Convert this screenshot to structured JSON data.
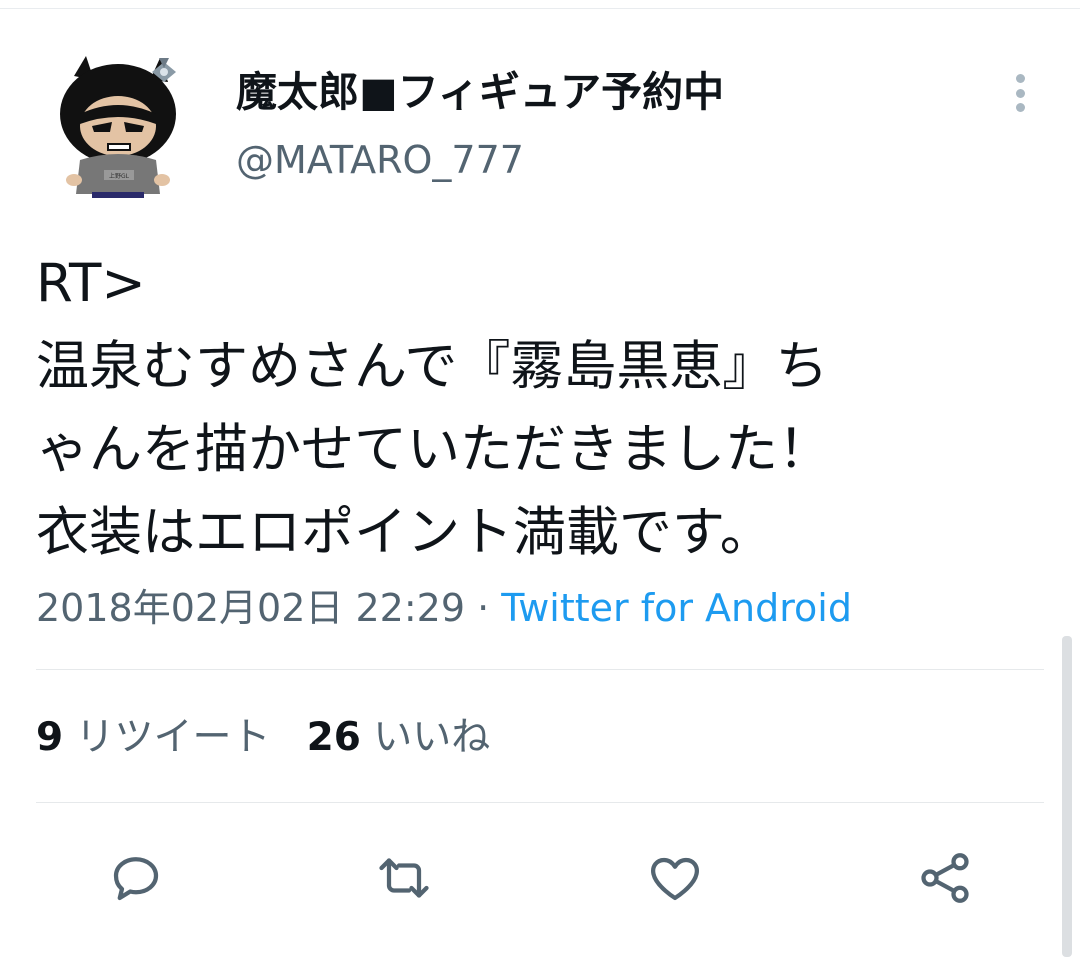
{
  "tweet": {
    "display_name": "魔太郎■フィギュア予約中",
    "handle": "@MATARO_777",
    "text": "RT>\n温泉むすめさんで『霧島黒恵』ち\nゃんを描かせていただきました！\n衣装はエロポイント満載です。",
    "timestamp": "2018年02月02日 22:29",
    "separator": " · ",
    "source": "Twitter for Android"
  },
  "stats": {
    "retweet_count": "9",
    "retweet_label": "リツイート",
    "like_count": "26",
    "like_label": "いいね"
  },
  "icons": {
    "more": "more-vertical-icon",
    "reply": "reply-icon",
    "retweet": "retweet-icon",
    "like": "heart-icon",
    "share": "share-icon"
  },
  "colors": {
    "link": "#1d9bf0",
    "secondary_text": "#536471",
    "primary_text": "#0f1419"
  }
}
